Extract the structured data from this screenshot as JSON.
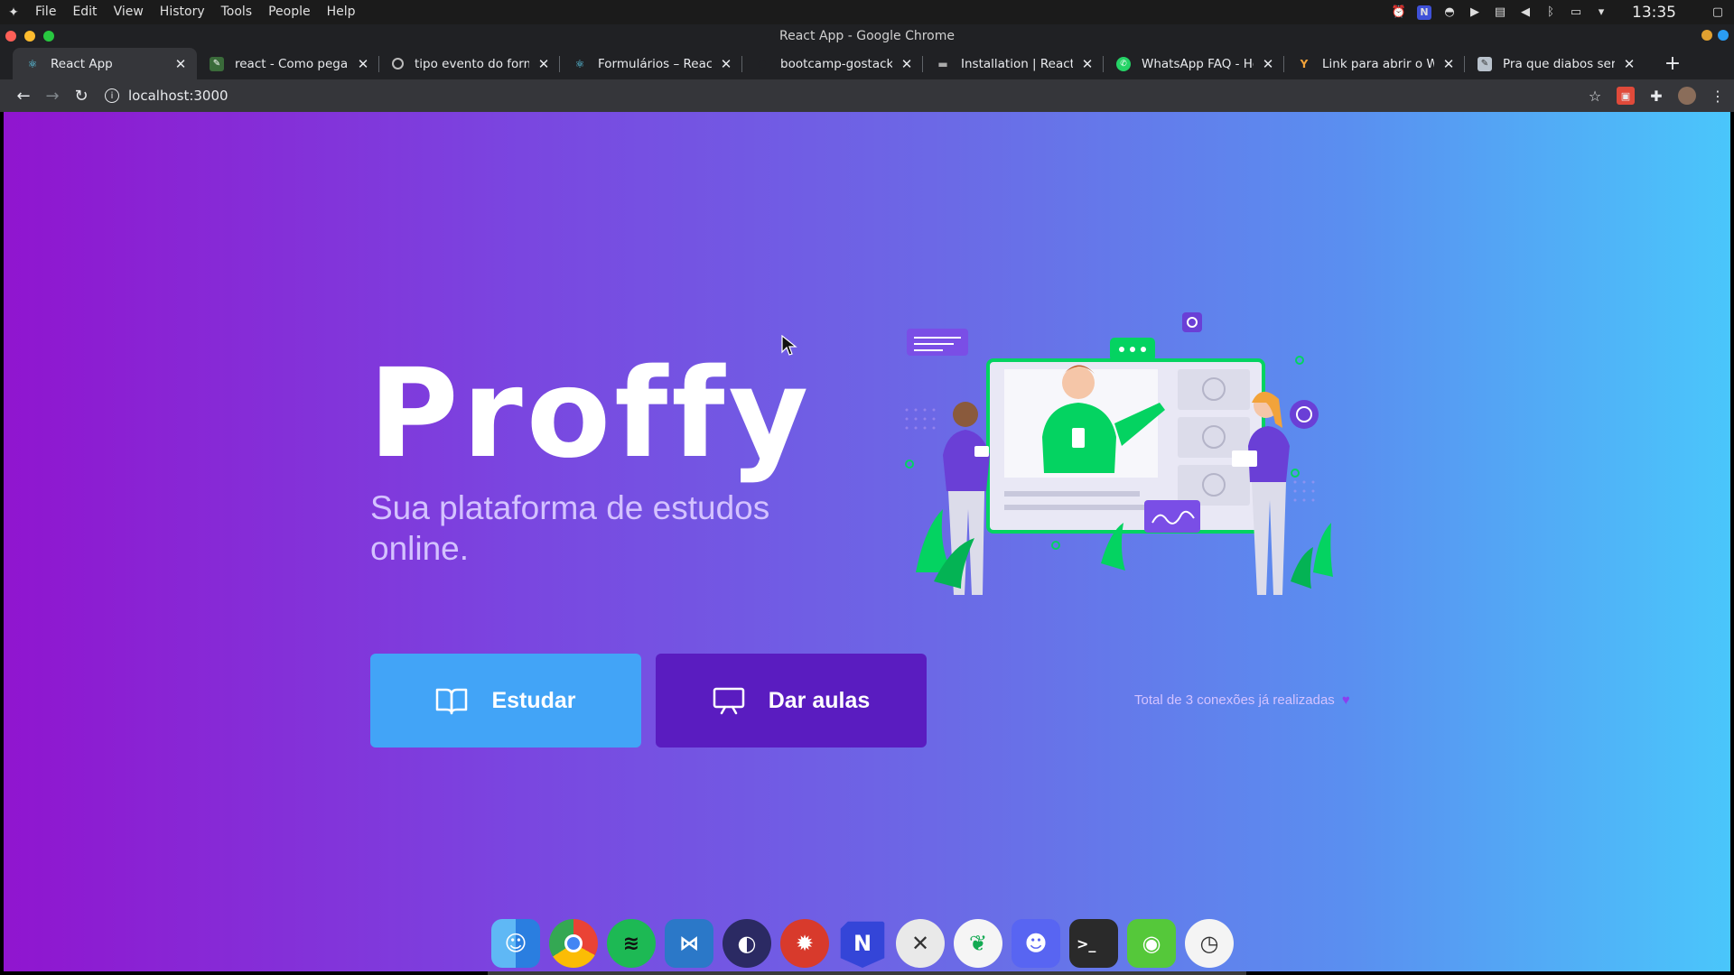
{
  "os_menu": {
    "items": [
      "File",
      "Edit",
      "View",
      "History",
      "Tools",
      "People",
      "Help"
    ],
    "clock": "13:35"
  },
  "window": {
    "title": "React App - Google Chrome"
  },
  "tabs": [
    {
      "title": "React App",
      "icon": "react-icon"
    },
    {
      "title": "react - Como pegar o",
      "icon": "stackoverflow-icon"
    },
    {
      "title": "tipo evento do formul",
      "icon": "google-icon"
    },
    {
      "title": "Formulários – React",
      "icon": "react-icon"
    },
    {
      "title": "bootcamp-gostack-g",
      "icon": "github-icon"
    },
    {
      "title": "Installation | React-To",
      "icon": "docs-icon"
    },
    {
      "title": "WhatsApp FAQ - How",
      "icon": "whatsapp-icon"
    },
    {
      "title": "Link para abrir o What",
      "icon": "link-icon"
    },
    {
      "title": "Pra que diabos serve",
      "icon": "page-icon"
    }
  ],
  "toolbar": {
    "url": "localhost:3000"
  },
  "landing": {
    "logo": "Proffy",
    "tagline": "Sua plataforma de estudos online.",
    "study_button": "Estudar",
    "teach_button": "Dar aulas",
    "connections": "Total de 3 conexões já realizadas"
  },
  "colors": {
    "study": "#42a4f7",
    "teach": "#5a1cc0",
    "gradient_start": "#9015cf",
    "gradient_end": "#4ac6fb"
  },
  "dock": [
    "finder-icon",
    "chrome-icon",
    "spotify-icon",
    "vscode-icon",
    "eclipse-icon",
    "postman-icon",
    "notion-icon",
    "xcode-icon",
    "mongodb-icon",
    "discord-icon",
    "terminal-icon",
    "screenshot-icon",
    "clock-icon"
  ]
}
